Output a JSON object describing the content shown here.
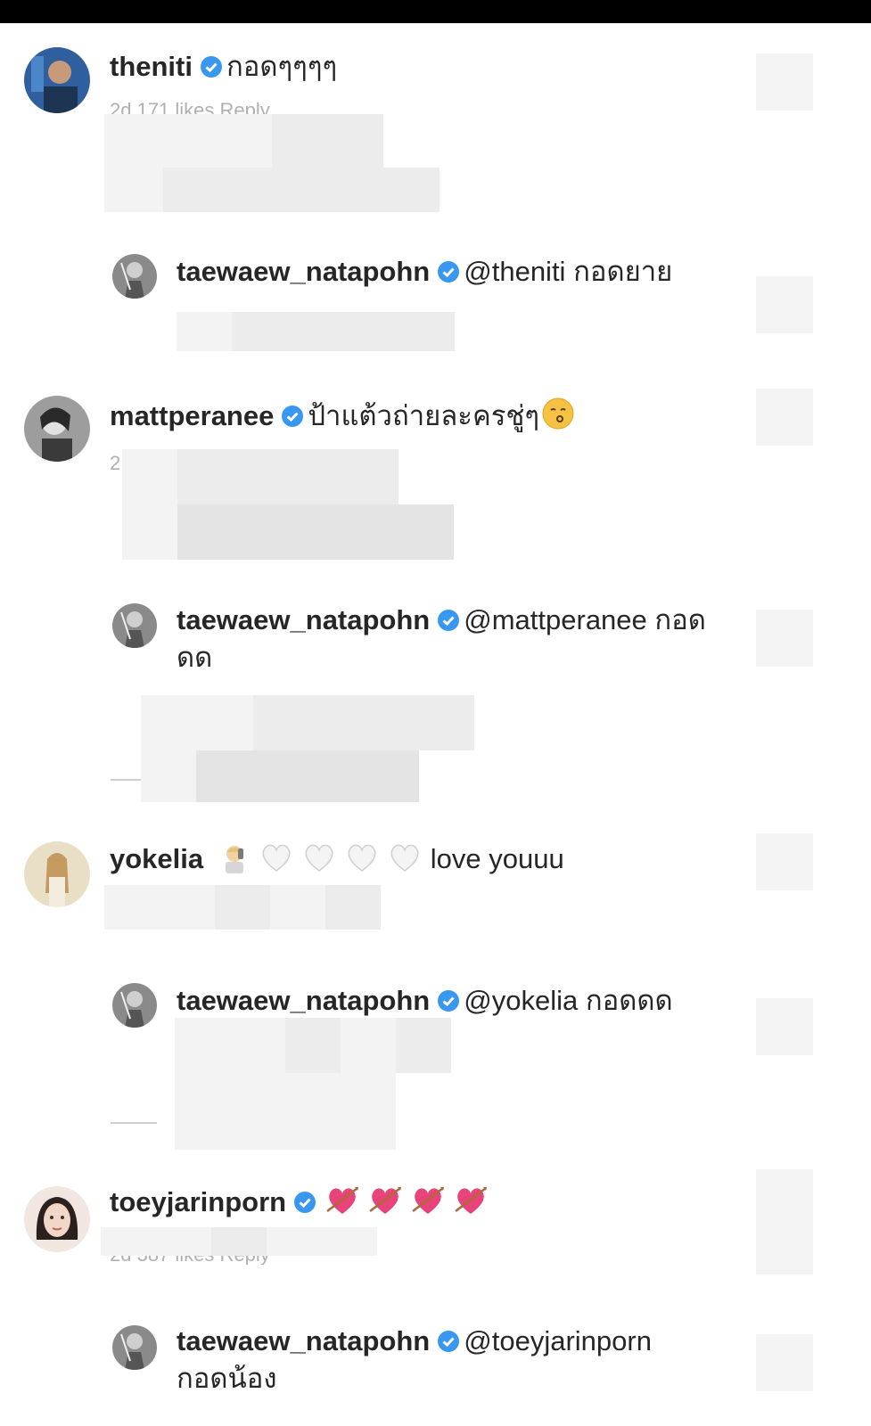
{
  "colors": {
    "verified": "#3897f0",
    "text": "#262626",
    "meta": "#b0b0b0"
  },
  "comments": [
    {
      "username": "theniti",
      "text": "กอดๆๆๆๆ",
      "meta": "2d    171 likes    Reply",
      "reply": {
        "username": "taewaew_natapohn",
        "mention": "@theniti",
        "text": "กอดยาย"
      }
    },
    {
      "username": "mattperanee",
      "text": "ป้าแต้วถ่ายละครชู่ๆ",
      "emoji": "kissing-face-icon",
      "meta": "2",
      "reply": {
        "username": "taewaew_natapohn",
        "mention": "@mattperanee",
        "text": "กอด",
        "text_line2": "ดด"
      }
    },
    {
      "username": "yokelia",
      "emojis": [
        "person-phone-icon",
        "white-heart-icon",
        "white-heart-icon",
        "white-heart-icon",
        "white-heart-icon"
      ],
      "text": "love youuu",
      "reply": {
        "username": "taewaew_natapohn",
        "mention": "@yokelia",
        "text": "กอดดด"
      }
    },
    {
      "username": "toeyjarinporn",
      "emojis": [
        "heart-with-arrow-icon",
        "heart-with-arrow-icon",
        "heart-with-arrow-icon",
        "heart-with-arrow-icon"
      ],
      "meta": "2d    387 likes    Reply",
      "reply": {
        "username": "taewaew_natapohn",
        "mention": "@toeyjarinporn",
        "text_line2": "กอดน้อง"
      }
    }
  ]
}
